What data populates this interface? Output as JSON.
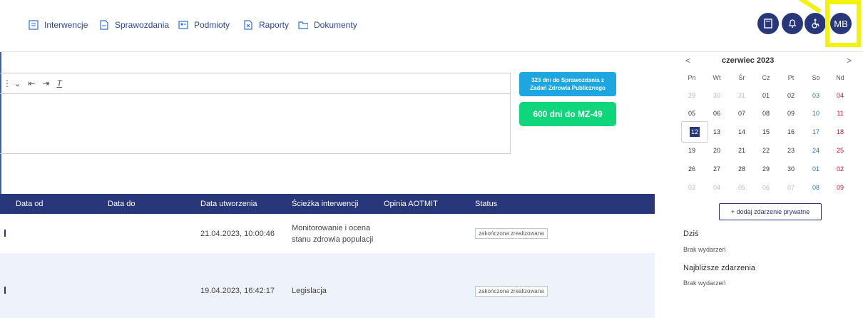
{
  "nav": {
    "items": [
      {
        "label": "Interwencje",
        "icon": "list-icon"
      },
      {
        "label": "Sprawozdania",
        "icon": "document-icon"
      },
      {
        "label": "Podmioty",
        "icon": "id-card-icon"
      },
      {
        "label": "Raporty",
        "icon": "spreadsheet-icon"
      },
      {
        "label": "Dokumenty",
        "icon": "folder-icon"
      }
    ],
    "user_initials": "MB"
  },
  "buttons": {
    "report_line1": "323 dni do Sprawozdania z",
    "report_line2": "Zadań Zdrowia Publicznego",
    "mz": "600 dni do MZ-49"
  },
  "table": {
    "headers": [
      "Data od",
      "Data do",
      "Data utworzenia",
      "Ścieżka interwencji",
      "Opinia AOTMIT",
      "Status"
    ],
    "rows": [
      {
        "created": "21.04.2023, 10:00:46",
        "path_line1": "Monitorowanie i ocena",
        "path_line2": "stanu zdrowia populacji",
        "status": "zakończona zrealizowana"
      },
      {
        "created": "19.04.2023, 16:42:17",
        "path_line1": "Legislacja",
        "path_line2": "",
        "status": "zakończona zrealizowana"
      }
    ]
  },
  "calendar": {
    "prev": "<",
    "next": ">",
    "title": "czerwiec 2023",
    "dow": [
      "Pn",
      "Wt",
      "Śr",
      "Cz",
      "Pt",
      "So",
      "Nd"
    ],
    "weeks": [
      [
        "29",
        "30",
        "31",
        "01",
        "02",
        "03",
        "04"
      ],
      [
        "05",
        "06",
        "07",
        "08",
        "09",
        "10",
        "11"
      ],
      [
        "12",
        "13",
        "14",
        "15",
        "16",
        "17",
        "18"
      ],
      [
        "19",
        "20",
        "21",
        "22",
        "23",
        "24",
        "25"
      ],
      [
        "26",
        "27",
        "28",
        "29",
        "30",
        "01",
        "02"
      ],
      [
        "03",
        "04",
        "05",
        "06",
        "07",
        "08",
        "09"
      ]
    ],
    "add_button": "+ dodaj zdarzenie prywatne",
    "today_label": "Dziś",
    "today_text": "Brak wydarzeń",
    "upcoming_label": "Najbliższe zdarzenia",
    "upcoming_text": "Brak wydarzeń"
  },
  "colors": {
    "primary": "#27377a",
    "accent_blue": "#1da6e0",
    "accent_green": "#0fd67a",
    "highlight": "#f2f20a"
  }
}
